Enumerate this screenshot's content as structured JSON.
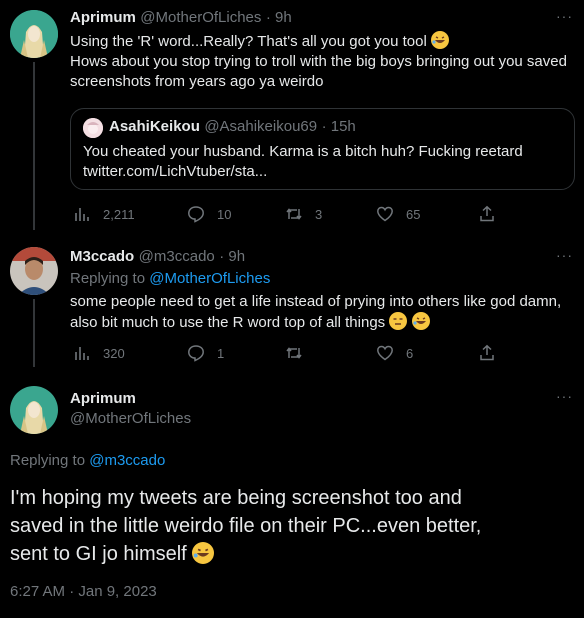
{
  "tweet1": {
    "name": "Aprimum",
    "handle": "@MotherOfLiches",
    "time": "· 9h",
    "text_line1": "Using the 'R' word...Really? That's all you got you tool",
    "text_line2": "Hows about you stop trying to troll with the big boys bringing out you saved",
    "text_line3": "screenshots from years ago ya weirdo",
    "emoji1": "rolling-on-floor-laughing",
    "quote": {
      "name": "AsahiKeikou",
      "handle": "@Asahikeikou69",
      "time": "· 15h",
      "text": "You cheated your husband. Karma is a bitch huh? Fucking reetard",
      "link": "twitter.com/LichVtuber/sta..."
    },
    "stats": {
      "views": "2,211",
      "replies": "10",
      "retweets": "3",
      "likes": "65"
    }
  },
  "tweet2": {
    "name": "M3ccado",
    "handle": "@m3ccado",
    "time": "· 9h",
    "replying_prefix": "Replying to",
    "replying_to": "@MotherOfLiches",
    "text_line1": "some people need to get a life instead of prying into others like god damn,",
    "text_line2": "also bit much to use the R word top of all things",
    "emojis": [
      "expressionless-face",
      "rolling-on-floor-laughing"
    ],
    "stats": {
      "views": "320",
      "replies": "1",
      "retweets": "",
      "likes": "6"
    }
  },
  "main_tweet": {
    "name": "Aprimum",
    "handle": "@MotherOfLiches",
    "replying_prefix": "Replying to",
    "replying_to": "@m3ccado",
    "text_line1": "I'm hoping my tweets are being screenshot too and",
    "text_line2": "saved in the little weirdo file on their PC...even better,",
    "text_line3": "sent to GI jo himself",
    "emoji": "rolling-on-floor-laughing",
    "timestamp": "6:27 AM · Jan 9, 2023"
  },
  "more_label": "···",
  "colors": {
    "accent": "#1d9bf0",
    "muted": "#71767b",
    "text": "#e7e9ea",
    "background": "#000000"
  }
}
